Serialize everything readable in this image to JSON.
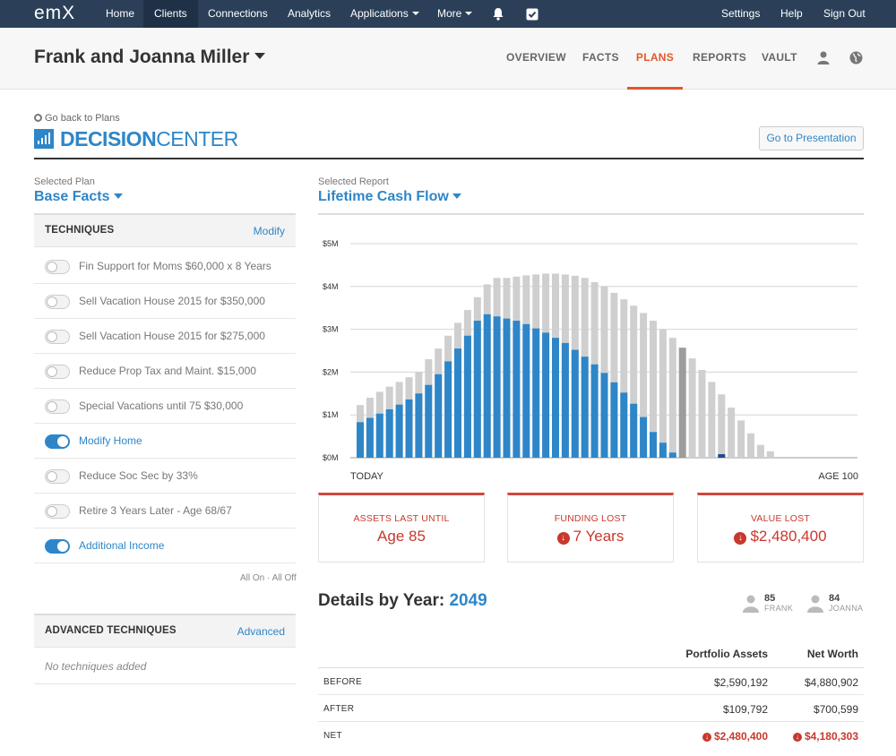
{
  "nav": {
    "logo": "emX",
    "items": [
      {
        "label": "Home",
        "active": false
      },
      {
        "label": "Clients",
        "active": true
      },
      {
        "label": "Connections",
        "active": false
      },
      {
        "label": "Analytics",
        "active": false
      },
      {
        "label": "Applications",
        "active": false
      },
      {
        "label": "More",
        "active": false
      }
    ],
    "right": {
      "settings": "Settings",
      "help": "Help",
      "signout": "Sign Out"
    }
  },
  "client": {
    "name": "Frank and Joanna Miller",
    "tabs": [
      "OVERVIEW",
      "FACTS",
      "PLANS",
      "REPORTS",
      "VAULT"
    ],
    "active_tab": "PLANS"
  },
  "decision_center": {
    "back_label": "Go back to Plans",
    "title_bold": "DECISION",
    "title_rest": "CENTER",
    "presentation_button": "Go to Presentation"
  },
  "plan": {
    "label": "Selected Plan",
    "value": "Base Facts"
  },
  "techniques": {
    "title": "TECHNIQUES",
    "modify_label": "Modify",
    "items": [
      {
        "label": "Fin Support for Moms $60,000 x 8 Years",
        "on": false
      },
      {
        "label": "Sell Vacation House 2015 for $350,000",
        "on": false
      },
      {
        "label": "Sell Vacation House 2015 for $275,000",
        "on": false
      },
      {
        "label": "Reduce Prop Tax and Maint. $15,000",
        "on": false
      },
      {
        "label": "Special Vacations until 75 $30,000",
        "on": false
      },
      {
        "label": "Modify Home",
        "on": true
      },
      {
        "label": "Reduce Soc Sec by 33%",
        "on": false
      },
      {
        "label": "Retire 3 Years Later - Age 68/67",
        "on": false
      },
      {
        "label": "Additional Income",
        "on": true
      }
    ],
    "all_on": "All On",
    "separator": "·",
    "all_off": "All Off"
  },
  "advanced": {
    "title": "ADVANCED TECHNIQUES",
    "link": "Advanced",
    "empty": "No techniques added"
  },
  "report": {
    "label": "Selected Report",
    "value": "Lifetime Cash Flow"
  },
  "colors": {
    "accent": "#2e86c8",
    "nav": "#2b4058",
    "alert": "#c9382c",
    "tab_active": "#e2582a",
    "bar_gray": "#cfcfcf",
    "bar_gray_dark": "#9c9c9c",
    "bar_navy": "#1e4e8c"
  },
  "chart_data": {
    "type": "bar",
    "title": "",
    "ylim": [
      0,
      5
    ],
    "yticks": [
      "$0M",
      "$1M",
      "$2M",
      "$3M",
      "$4M",
      "$5M"
    ],
    "x_start_label": "TODAY",
    "x_end_label": "AGE 100",
    "grid": true,
    "series": [
      {
        "values": [
          1.23,
          1.4,
          1.54,
          1.66,
          1.77,
          1.88,
          2.0,
          2.3,
          2.55,
          2.85,
          3.15,
          3.45,
          3.75,
          4.05,
          4.2,
          4.2,
          4.23,
          4.26,
          4.28,
          4.3,
          4.3,
          4.28,
          4.25,
          4.2,
          4.1,
          4.0,
          3.85,
          3.7,
          3.55,
          3.38,
          3.2,
          3.0,
          2.8,
          2.57,
          2.32,
          2.05,
          1.77,
          1.48,
          1.17,
          0.87,
          0.57,
          0.3,
          0.15
        ]
      },
      {
        "values": [
          0.83,
          0.93,
          1.03,
          1.13,
          1.24,
          1.36,
          1.5,
          1.7,
          1.95,
          2.25,
          2.55,
          2.85,
          3.2,
          3.35,
          3.3,
          3.25,
          3.2,
          3.12,
          3.02,
          2.92,
          2.8,
          2.68,
          2.52,
          2.36,
          2.18,
          1.98,
          1.76,
          1.52,
          1.26,
          0.95,
          0.6,
          0.35,
          0.12,
          0,
          0,
          0,
          0,
          0,
          0,
          0,
          0,
          0,
          0
        ]
      }
    ]
  },
  "metrics": [
    {
      "title": "ASSETS LAST UNTIL",
      "value": "Age 85",
      "icon": false
    },
    {
      "title": "FUNDING LOST",
      "value": "7 Years",
      "icon": true
    },
    {
      "title": "VALUE LOST",
      "value": "$2,480,400",
      "icon": true
    }
  ],
  "details": {
    "title": "Details by Year:",
    "year": "2049",
    "people": [
      {
        "age": "85",
        "name": "FRANK"
      },
      {
        "age": "84",
        "name": "JOANNA"
      }
    ],
    "columns": [
      "Portfolio Assets",
      "Net Worth"
    ],
    "rows": [
      {
        "label": "BEFORE",
        "assets": "$2,590,192",
        "networth": "$4,880,902",
        "negative": false
      },
      {
        "label": "AFTER",
        "assets": "$109,792",
        "networth": "$700,599",
        "negative": false
      },
      {
        "label": "NET",
        "assets": "$2,480,400",
        "networth": "$4,180,303",
        "negative": true
      }
    ]
  }
}
